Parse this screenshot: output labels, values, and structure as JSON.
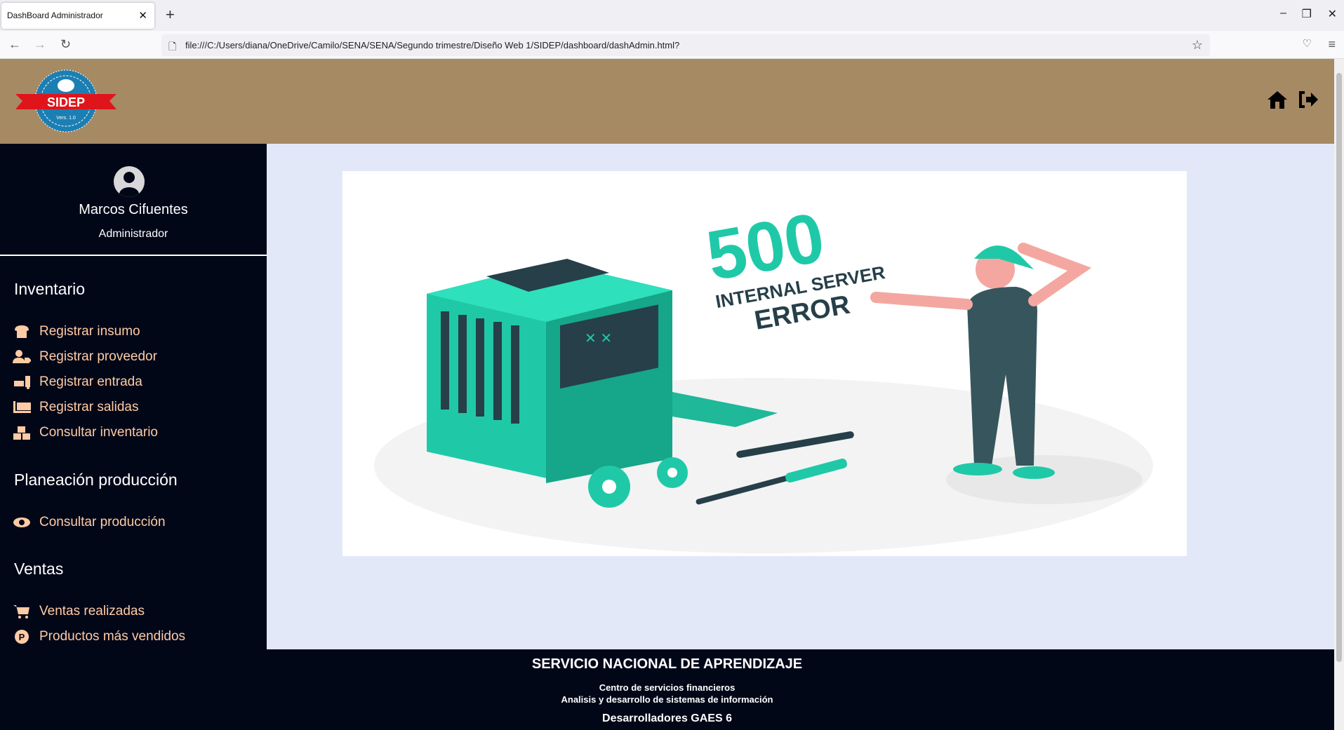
{
  "browser": {
    "tab_title": "DashBoard Administrador",
    "url": "file:///C:/Users/diana/OneDrive/Camilo/SENA/SENA/Segundo trimestre/Diseño Web 1/SIDEP/dashboard/dashAdmin.html?"
  },
  "header": {
    "logo_text": "SIDEP",
    "logo_version": "Vers. 1.0"
  },
  "profile": {
    "name": "Marcos Cifuentes",
    "role": "Administrador"
  },
  "sidebar": {
    "sections": [
      {
        "title": "Inventario",
        "items": [
          {
            "label": "Registrar insumo",
            "icon": "bread-icon"
          },
          {
            "label": "Registrar proveedor",
            "icon": "user-tag-icon"
          },
          {
            "label": "Registrar entrada",
            "icon": "dolly-icon"
          },
          {
            "label": "Registrar salidas",
            "icon": "pallet-icon"
          },
          {
            "label": "Consultar inventario",
            "icon": "boxes-icon"
          }
        ]
      },
      {
        "title": "Planeación producción",
        "items": [
          {
            "label": "Consultar producción",
            "icon": "eye-icon"
          }
        ]
      },
      {
        "title": "Ventas",
        "items": [
          {
            "label": "Ventas realizadas",
            "icon": "cart-icon"
          },
          {
            "label": "Productos más vendidos",
            "icon": "product-p-icon"
          }
        ]
      }
    ]
  },
  "illustration": {
    "code": "500",
    "line1": "INTERNAL SERVER",
    "line2": "ERROR"
  },
  "footer": {
    "title": "SERVICIO NACIONAL DE APRENDIZAJE",
    "line1": "Centro de servicios financieros",
    "line2": "Analisis y desarrollo de sistemas de información",
    "devs": "Desarrolladores GAES 6"
  },
  "colors": {
    "header": "#a68a64",
    "sidebar": "#020718",
    "main_bg": "#e3e8f9",
    "menu_text": "#ffcba4",
    "teal": "#1fc9a8"
  }
}
